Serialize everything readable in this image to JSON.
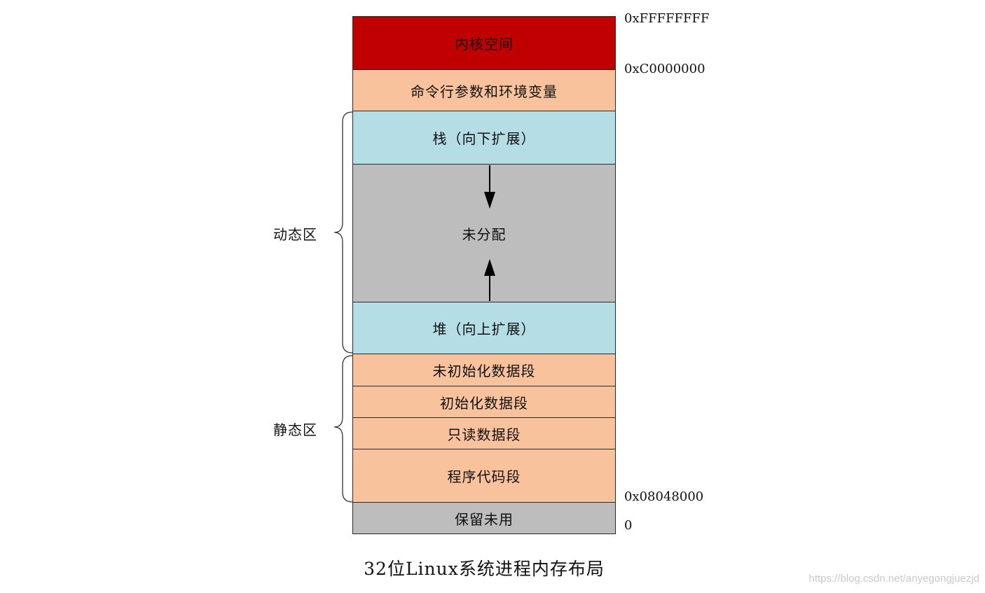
{
  "segments": {
    "kernel": {
      "label": "内核空间",
      "color": "#c00000"
    },
    "args_env": {
      "label": "命令行参数和环境变量",
      "color": "#f8c29c"
    },
    "stack": {
      "label": "栈（向下扩展）",
      "color": "#b5dde6"
    },
    "unallocated": {
      "label": "未分配",
      "color": "#bdbdbd"
    },
    "heap": {
      "label": "堆（向上扩展）",
      "color": "#b5dde6"
    },
    "bss": {
      "label": "未初始化数据段",
      "color": "#f8c29c"
    },
    "data": {
      "label": "初始化数据段",
      "color": "#f8c29c"
    },
    "rodata": {
      "label": "只读数据段",
      "color": "#f8c29c"
    },
    "text": {
      "label": "程序代码段",
      "color": "#f8c29c"
    },
    "reserved": {
      "label": "保留未用",
      "color": "#bdbdbd"
    }
  },
  "addresses": {
    "top": "0xFFFFFFFF",
    "kernel_start": "0xC0000000",
    "code_start": "0x08048000",
    "bottom": "0"
  },
  "zones": {
    "dynamic": "动态区",
    "static": "静态区"
  },
  "caption": "32位Linux系统进程内存布局",
  "watermark": "https://blog.csdn.net/anyegongjuezjd"
}
